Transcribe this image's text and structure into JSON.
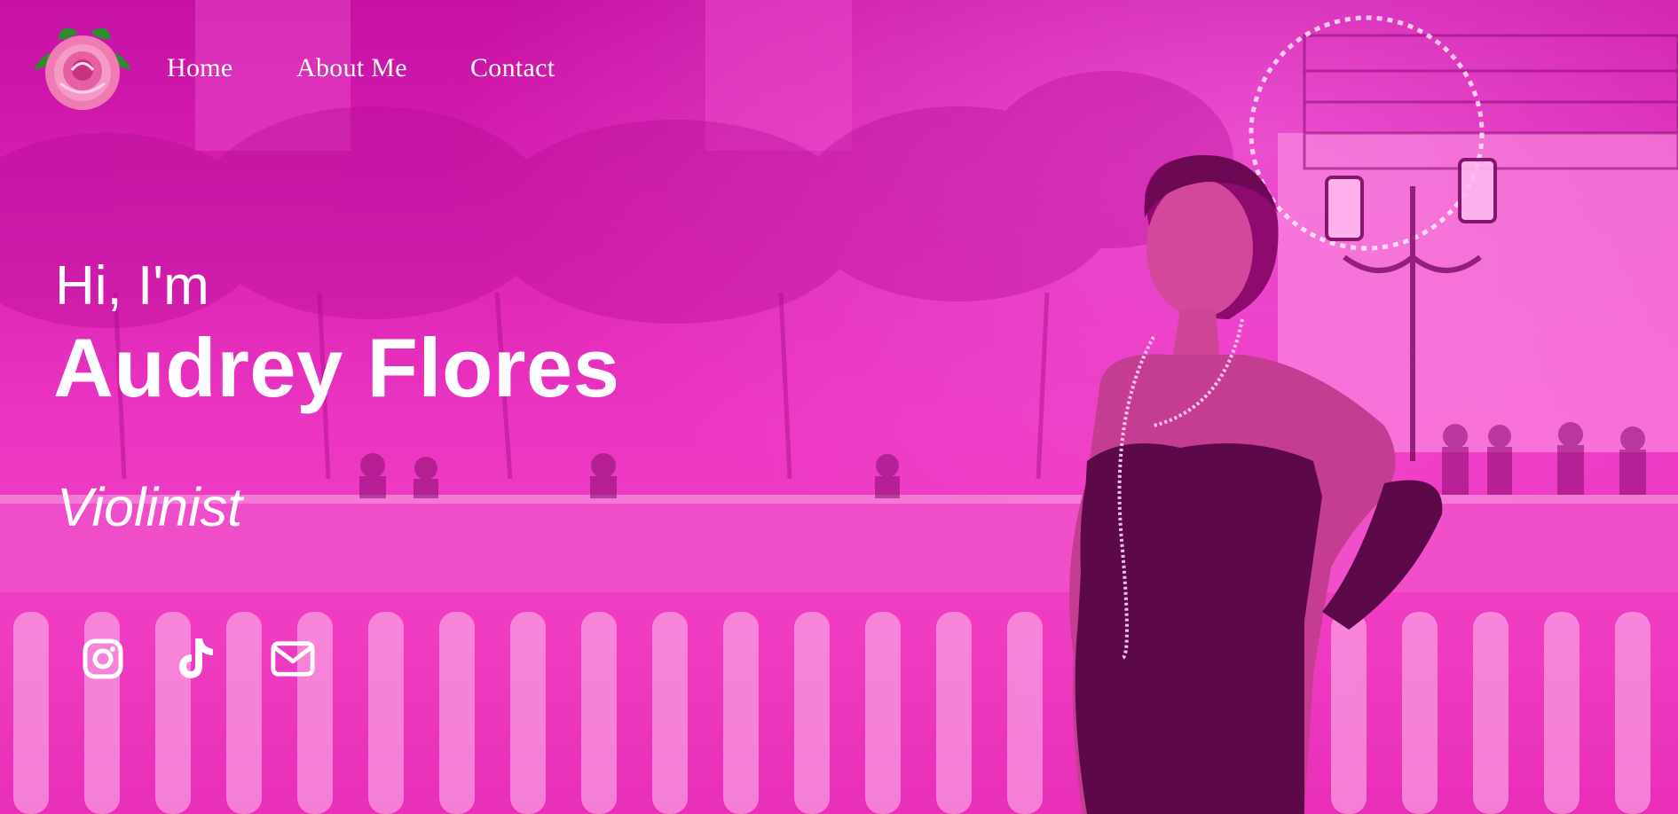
{
  "nav": {
    "links": [
      {
        "label": "Home"
      },
      {
        "label": "About Me"
      },
      {
        "label": "Contact"
      }
    ],
    "logo_icon": "rose-icon"
  },
  "hero": {
    "greeting": "Hi, I'm",
    "name": "Audrey Flores",
    "role": "Violinist",
    "overlay_color": "#e62db9"
  },
  "social": [
    {
      "icon": "instagram-icon"
    },
    {
      "icon": "tiktok-icon"
    },
    {
      "icon": "mail-icon"
    }
  ]
}
